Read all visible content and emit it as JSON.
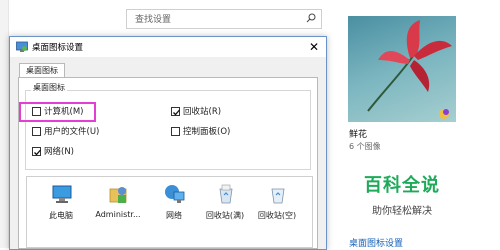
{
  "settings": {
    "search": {
      "placeholder": "查找设置"
    },
    "theme": {
      "name": "鲜花",
      "count": "6 个图像"
    },
    "link": "桌面图标设置"
  },
  "watermark": {
    "title": "百科全说",
    "subtitle": "助你轻松解决"
  },
  "dialog": {
    "title": "桌面图标设置",
    "close": "✕",
    "tab": "桌面图标",
    "group_label": "桌面图标",
    "checkboxes": [
      {
        "label": "计算机(M)",
        "checked": false
      },
      {
        "label": "回收站(R)",
        "checked": true
      },
      {
        "label": "用户的文件(U)",
        "checked": false
      },
      {
        "label": "控制面板(O)",
        "checked": false
      },
      {
        "label": "网络(N)",
        "checked": true
      }
    ],
    "icons": [
      {
        "label": "此电脑",
        "icon": "computer-icon"
      },
      {
        "label": "Administr...",
        "icon": "user-folder-icon"
      },
      {
        "label": "网络",
        "icon": "network-icon"
      },
      {
        "label": "回收站(满)",
        "icon": "recycle-bin-full-icon"
      },
      {
        "label": "回收站(空)",
        "icon": "recycle-bin-empty-icon"
      }
    ]
  },
  "colors": {
    "accent": "#1561b7",
    "highlight": "#e43fd4",
    "watermark": "#1faa5a"
  }
}
